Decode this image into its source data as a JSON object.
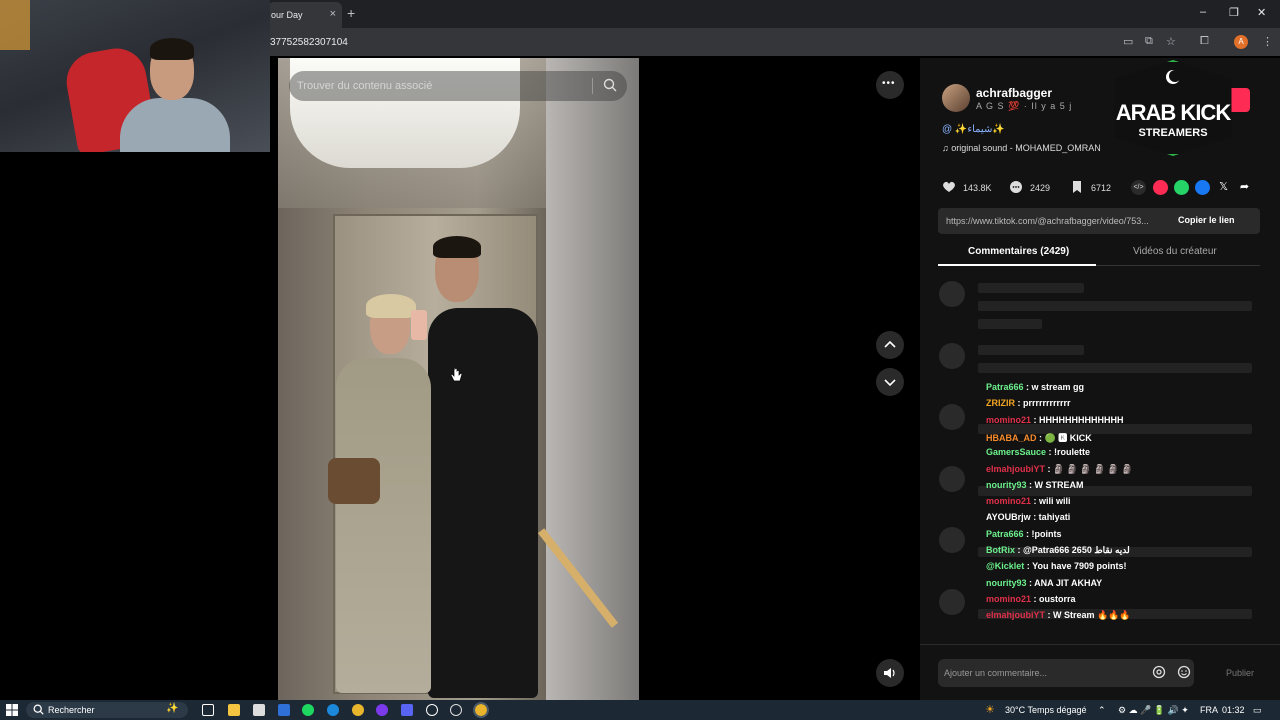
{
  "browser": {
    "tab_title": "our Day",
    "tab_close": "×",
    "new_tab": "+",
    "url": "37752582307104",
    "win_minimize": "–",
    "win_restore": "❐",
    "win_close": "✕",
    "profile_initial": "A"
  },
  "video": {
    "search_placeholder": "Trouver du contenu associé",
    "more_label": "•••"
  },
  "author": {
    "username": "achrafbagger",
    "subtitle": "A G S 💯 · Il y a 5 j",
    "caption": "@ ✨شيماء✨",
    "sound": "original sound - MOHAMED_OMRAN"
  },
  "stats": {
    "likes": "143.8K",
    "comments": "2429",
    "saves": "6712"
  },
  "share": {
    "link": "https://www.tiktok.com/@achrafbagger/video/753...",
    "copy_label": "Copier le lien"
  },
  "tabs": {
    "comments": "Commentaires (2429)",
    "creator_videos": "Vidéos du créateur"
  },
  "logo": {
    "line1": "ARAB KICK",
    "line2": "STREAMERS"
  },
  "chat": [
    {
      "user": "Patra666",
      "msg": " : w stream gg",
      "color": "#6cf08c"
    },
    {
      "user": "ZRIZIR",
      "msg": " : prrrrrrrrrrrr",
      "color": "#f5a623"
    },
    {
      "user": "momino21",
      "msg": " : HHHHHHHHHHHHH",
      "color": "#e0304a"
    },
    {
      "user": "HBABA_AD",
      "msg": " : 🟢 🅺 KICK",
      "color": "#f58a2b"
    },
    {
      "user": "GamersSauce",
      "msg": " : !roulette",
      "color": "#6cf08c"
    },
    {
      "user": "elmahjoubiYT",
      "msg": " : 🗿 🗿 🗿 🗿 🗿 🗿",
      "color": "#e0304a"
    },
    {
      "user": "nourity93",
      "msg": " : W STREAM",
      "color": "#6cf08c"
    },
    {
      "user": "momino21",
      "msg": " : wili wili",
      "color": "#e0304a"
    },
    {
      "user": "AYOUBrjw",
      "msg": " : tahiyati",
      "color": "#ffffff"
    },
    {
      "user": "Patra666",
      "msg": " : !points",
      "color": "#6cf08c"
    },
    {
      "user": "BotRix",
      "msg": " : @Patra666 2650 لديه نقاط",
      "color": "#6cf08c"
    },
    {
      "user": "@Kicklet",
      "msg": " : You have 7909 points!",
      "color": "#6cf08c"
    },
    {
      "user": "nourity93",
      "msg": " : ANA JIT AKHAY",
      "color": "#6cf08c"
    },
    {
      "user": "momino21",
      "msg": " : oustorra",
      "color": "#e0304a"
    },
    {
      "user": "elmahjoubiYT",
      "msg": " : W Stream 🔥🔥🔥",
      "color": "#e0304a"
    }
  ],
  "comment_box": {
    "placeholder": "Ajouter un commentaire...",
    "publish_label": "Publier"
  },
  "taskbar": {
    "search_placeholder": "Rechercher",
    "weather": "30°C  Temps dégagé",
    "lang": "FRA",
    "time": "01:32"
  },
  "colors": {
    "accent": "#fe2c55",
    "logo_green": "#2db84a"
  }
}
